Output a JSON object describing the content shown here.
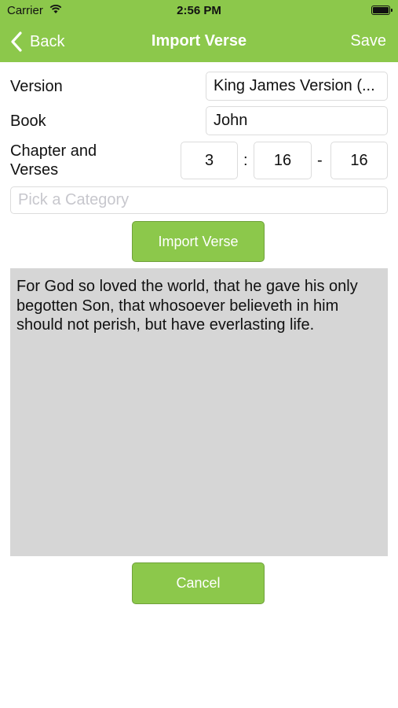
{
  "status_bar": {
    "carrier": "Carrier",
    "time": "2:56 PM"
  },
  "nav": {
    "back_label": "Back",
    "title": "Import Verse",
    "save_label": "Save"
  },
  "form": {
    "version_label": "Version",
    "version_value": "King James Version (...",
    "book_label": "Book",
    "book_value": "John",
    "chapter_label_line1": "Chapter and",
    "chapter_label_line2": "Verses",
    "chapter_value": "3",
    "colon": ":",
    "verse_start": "16",
    "dash": "-",
    "verse_end": "16",
    "category_placeholder": "Pick a Category"
  },
  "import_button_label": "Import Verse",
  "verse_text": "For God so loved the world, that he gave his only begotten Son, that whosoever believeth in him should not perish, but have everlasting life.",
  "cancel_button_label": "Cancel",
  "colors": {
    "accent": "#8cc84b",
    "text_area_bg": "#d6d6d6"
  }
}
